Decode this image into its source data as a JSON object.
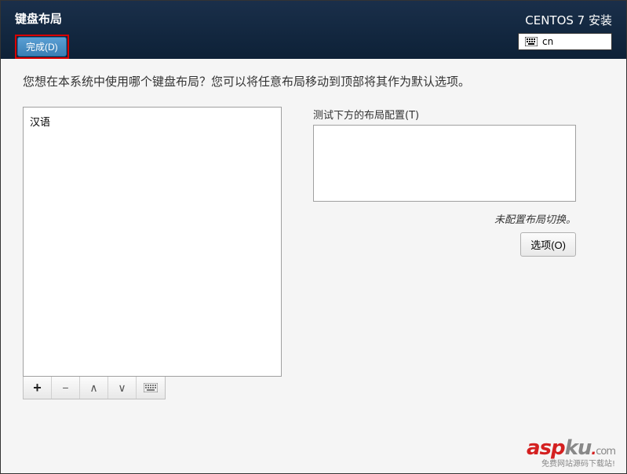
{
  "header": {
    "title": "键盘布局",
    "done_button": "完成(D)",
    "distro": "CENTOS 7 安装",
    "lang_code": "cn"
  },
  "content": {
    "instruction": "您想在本系统中使用哪个键盘布局？您可以将任意布局移动到顶部将其作为默认选项。",
    "layouts": [
      "汉语"
    ],
    "test_label": "测试下方的布局配置(T)",
    "test_value": "",
    "not_configured": "未配置布局切换。",
    "options_button": "选项(O)"
  },
  "toolbar": {
    "add": "+",
    "remove": "−",
    "up": "∧",
    "down": "∨"
  },
  "watermark": {
    "brand_red": "asp",
    "brand_gray": "ku",
    "dot": ".",
    "tld": "com",
    "subtitle": "免费网站源码下载站!"
  }
}
